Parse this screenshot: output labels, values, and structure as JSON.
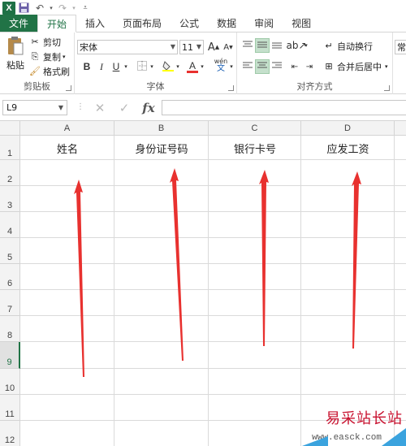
{
  "quick_access": {
    "logo": "X",
    "save_icon": "save-icon",
    "undo_icon": "undo-icon",
    "redo_icon": "redo-icon"
  },
  "tabs": {
    "file": "文件",
    "items": [
      "开始",
      "插入",
      "页面布局",
      "公式",
      "数据",
      "审阅",
      "视图"
    ],
    "active": "开始"
  },
  "ribbon": {
    "clipboard": {
      "paste": "粘贴",
      "cut": "剪切",
      "copy": "复制",
      "format_painter": "格式刷",
      "label": "剪贴板"
    },
    "font": {
      "font_name": "宋体",
      "font_size": "11",
      "bold": "B",
      "italic": "I",
      "underline": "U",
      "grow": "A",
      "shrink": "A",
      "font_color": "A",
      "phonetic": "wén",
      "label": "字体"
    },
    "alignment": {
      "wrap": "自动换行",
      "merge": "合并后居中",
      "label": "对齐方式"
    },
    "number": {
      "format_partial": "常"
    }
  },
  "formula_bar": {
    "name_box": "L9",
    "cancel": "✕",
    "enter": "✓",
    "fx": "fx",
    "value": ""
  },
  "sheet": {
    "columns": [
      "A",
      "B",
      "C",
      "D"
    ],
    "rows": [
      "1",
      "2",
      "3",
      "4",
      "5",
      "6",
      "7",
      "8",
      "9",
      "10",
      "11",
      "12"
    ],
    "active_row": "9",
    "headers": [
      "姓名",
      "身份证号码",
      "银行卡号",
      "应发工资"
    ]
  },
  "colors": {
    "excel_green": "#217346",
    "arrow_red": "#e8312f",
    "watermark_red": "#c8102e",
    "watermark_blue": "#3ba3de"
  },
  "watermark": {
    "title": "易采站长站",
    "url": "www.easck.com"
  }
}
